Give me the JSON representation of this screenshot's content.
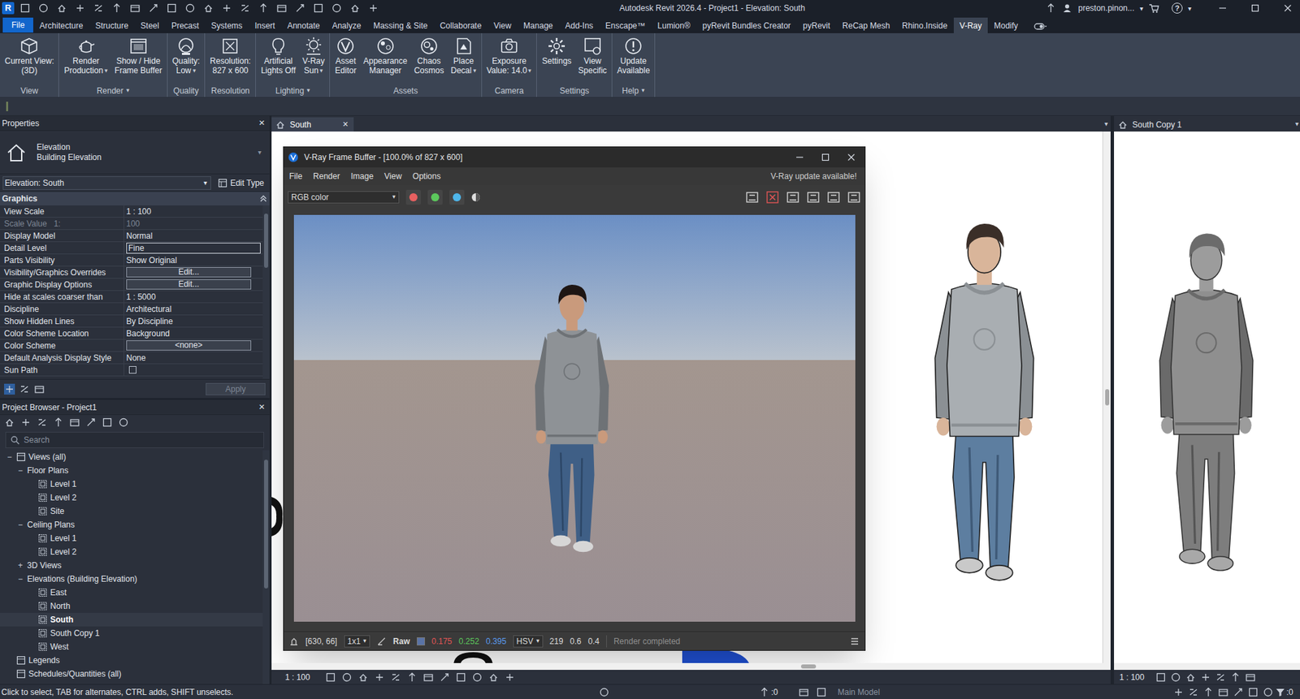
{
  "window": {
    "app_logo": "R",
    "title": "Autodesk Revit 2026.4 - Project1 - Elevation: South",
    "user": "preston.pinon...",
    "user_caret": "▾",
    "help": "?",
    "help_caret": "▾"
  },
  "ribbon_tabs": [
    {
      "label": "File",
      "selected": false,
      "kind": "file"
    },
    {
      "label": "Architecture",
      "selected": false,
      "kind": "tab"
    },
    {
      "label": "Structure",
      "selected": false,
      "kind": "tab"
    },
    {
      "label": "Steel",
      "selected": false,
      "kind": "tab"
    },
    {
      "label": "Precast",
      "selected": false,
      "kind": "tab"
    },
    {
      "label": "Systems",
      "selected": false,
      "kind": "tab"
    },
    {
      "label": "Insert",
      "selected": false,
      "kind": "tab"
    },
    {
      "label": "Annotate",
      "selected": false,
      "kind": "tab"
    },
    {
      "label": "Analyze",
      "selected": false,
      "kind": "tab"
    },
    {
      "label": "Massing & Site",
      "selected": false,
      "kind": "tab"
    },
    {
      "label": "Collaborate",
      "selected": false,
      "kind": "tab"
    },
    {
      "label": "View",
      "selected": false,
      "kind": "tab"
    },
    {
      "label": "Manage",
      "selected": false,
      "kind": "tab"
    },
    {
      "label": "Add-Ins",
      "selected": false,
      "kind": "tab"
    },
    {
      "label": "Enscape™",
      "selected": false,
      "kind": "tab"
    },
    {
      "label": "Lumion®",
      "selected": false,
      "kind": "tab"
    },
    {
      "label": "pyRevit Bundles Creator",
      "selected": false,
      "kind": "tab"
    },
    {
      "label": "pyRevit",
      "selected": false,
      "kind": "tab"
    },
    {
      "label": "ReCap Mesh",
      "selected": false,
      "kind": "tab"
    },
    {
      "label": "Rhino.Inside",
      "selected": false,
      "kind": "tab"
    },
    {
      "label": "V-Ray",
      "selected": true,
      "kind": "tab"
    },
    {
      "label": "Modify",
      "selected": false,
      "kind": "tab"
    }
  ],
  "ribbon_panels": [
    {
      "name": "View",
      "buttons": [
        {
          "lines": [
            "Current View:",
            "(3D)"
          ]
        }
      ]
    },
    {
      "name": "Render",
      "caret": "▾",
      "buttons": [
        {
          "lines": [
            "Render",
            "Production"
          ],
          "caret": "▾"
        },
        {
          "lines": [
            "Show / Hide",
            "Frame Buffer"
          ]
        }
      ]
    },
    {
      "name": "Quality",
      "buttons": [
        {
          "lines": [
            "Quality:",
            "Low"
          ],
          "caret": "▾"
        }
      ]
    },
    {
      "name": "Resolution",
      "buttons": [
        {
          "lines": [
            "Resolution:",
            "827 x 600"
          ]
        }
      ]
    },
    {
      "name": "Lighting",
      "caret": "▾",
      "buttons": [
        {
          "lines": [
            "Artificial",
            "Lights Off"
          ]
        },
        {
          "lines": [
            "V-Ray",
            "Sun"
          ],
          "caret": "▾"
        }
      ]
    },
    {
      "name": "Assets",
      "buttons": [
        {
          "lines": [
            "Asset",
            "Editor"
          ]
        },
        {
          "lines": [
            "Appearance",
            "Manager"
          ]
        },
        {
          "lines": [
            "Chaos",
            "Cosmos"
          ]
        },
        {
          "lines": [
            "Place",
            "Decal"
          ],
          "caret": "▾"
        }
      ]
    },
    {
      "name": "Camera",
      "buttons": [
        {
          "lines": [
            "Exposure",
            "Value: 14.0"
          ],
          "caret": "▾"
        }
      ]
    },
    {
      "name": "Settings",
      "buttons": [
        {
          "lines": [
            "Settings"
          ]
        },
        {
          "lines": [
            "View",
            "Specific"
          ]
        }
      ]
    },
    {
      "name": "Help",
      "caret": "▾",
      "buttons": [
        {
          "lines": [
            "Update",
            "Available"
          ]
        }
      ]
    }
  ],
  "properties": {
    "title": "Properties",
    "close": "×",
    "type_lines": [
      "Elevation",
      "Building Elevation"
    ],
    "type_caret": "▾",
    "selector": "Elevation: South",
    "selector_caret": "▾",
    "edit_type": "Edit Type",
    "group": "Graphics",
    "apply": "Apply",
    "rows": [
      {
        "name": "View Scale",
        "value": "1 : 100",
        "kind": "text",
        "disabled": false
      },
      {
        "name": "Scale Value",
        "prefix": "1:",
        "value": "100",
        "kind": "text",
        "disabled": true
      },
      {
        "name": "Display Model",
        "value": "Normal",
        "kind": "text",
        "disabled": false
      },
      {
        "name": "Detail Level",
        "value": "Fine",
        "kind": "field",
        "disabled": false
      },
      {
        "name": "Parts Visibility",
        "value": "Show Original",
        "kind": "text",
        "disabled": false
      },
      {
        "name": "Visibility/Graphics Overrides",
        "value": "Edit...",
        "kind": "button",
        "disabled": false
      },
      {
        "name": "Graphic Display Options",
        "value": "Edit...",
        "kind": "button",
        "disabled": false
      },
      {
        "name": "Hide at scales coarser than",
        "value": "1 : 5000",
        "kind": "text",
        "disabled": false
      },
      {
        "name": "Discipline",
        "value": "Architectural",
        "kind": "text",
        "disabled": false
      },
      {
        "name": "Show Hidden Lines",
        "value": "By Discipline",
        "kind": "text",
        "disabled": false
      },
      {
        "name": "Color Scheme Location",
        "value": "Background",
        "kind": "text",
        "disabled": false
      },
      {
        "name": "Color Scheme",
        "value": "<none>",
        "kind": "button",
        "disabled": false
      },
      {
        "name": "Default Analysis Display Style",
        "value": "None",
        "kind": "text",
        "disabled": false
      },
      {
        "name": "Sun Path",
        "kind": "checkbox",
        "checked": false,
        "disabled": false
      }
    ]
  },
  "project_browser": {
    "title": "Project Browser - Project1",
    "close": "×",
    "search_placeholder": "Search",
    "items": [
      {
        "label": "Views (all)",
        "depth": 0,
        "toggle": "−",
        "kind": "root",
        "selected": false
      },
      {
        "label": "Floor Plans",
        "depth": 1,
        "toggle": "−",
        "kind": "group",
        "selected": false
      },
      {
        "label": "Level 1",
        "depth": 2,
        "kind": "view",
        "selected": false
      },
      {
        "label": "Level 2",
        "depth": 2,
        "kind": "view",
        "selected": false
      },
      {
        "label": "Site",
        "depth": 2,
        "kind": "view",
        "selected": false
      },
      {
        "label": "Ceiling Plans",
        "depth": 1,
        "toggle": "−",
        "kind": "group",
        "selected": false
      },
      {
        "label": "Level 1",
        "depth": 2,
        "kind": "view",
        "selected": false
      },
      {
        "label": "Level 2",
        "depth": 2,
        "kind": "view",
        "selected": false
      },
      {
        "label": "3D Views",
        "depth": 1,
        "toggle": "+",
        "kind": "group",
        "selected": false
      },
      {
        "label": "Elevations (Building Elevation)",
        "depth": 1,
        "toggle": "−",
        "kind": "group",
        "selected": false
      },
      {
        "label": "East",
        "depth": 2,
        "kind": "view",
        "selected": false
      },
      {
        "label": "North",
        "depth": 2,
        "kind": "view",
        "selected": false
      },
      {
        "label": "South",
        "depth": 2,
        "kind": "view",
        "selected": true
      },
      {
        "label": "South Copy 1",
        "depth": 2,
        "kind": "view",
        "selected": false
      },
      {
        "label": "West",
        "depth": 2,
        "kind": "view",
        "selected": false
      },
      {
        "label": "Legends",
        "depth": 0,
        "kind": "root",
        "selected": false
      },
      {
        "label": "Schedules/Quantities (all)",
        "depth": 0,
        "kind": "root",
        "selected": false
      }
    ]
  },
  "main_view": {
    "tab": "South",
    "close": "×",
    "tab_menu": "▾",
    "scale": "1 : 100"
  },
  "side_view": {
    "tab": "South Copy 1",
    "tab_menu": "▾",
    "scale": "1 : 100"
  },
  "frame_buffer": {
    "title": "V-Ray Frame Buffer - [100.0% of 827 x 600]",
    "menu": [
      "File",
      "Render",
      "Image",
      "View",
      "Options"
    ],
    "notice": "V-Ray update available!",
    "channel": "RGB color",
    "channel_caret": "▾",
    "status": {
      "coords": "[630, 66]",
      "zoom": "1x1",
      "zoom_caret": "▾",
      "mode": "Raw",
      "r": "0.175",
      "g": "0.252",
      "b": "0.395",
      "space": "HSV",
      "space_caret": "▾",
      "h": "219",
      "s": "0.6",
      "v": "0.4",
      "message": "Render completed"
    }
  },
  "status_bar": {
    "message": "Click to select, TAB for alternates, CTRL adds, SHIFT unselects.",
    "selected_count": ":0",
    "model": "Main Model",
    "filter_count": ":0"
  }
}
